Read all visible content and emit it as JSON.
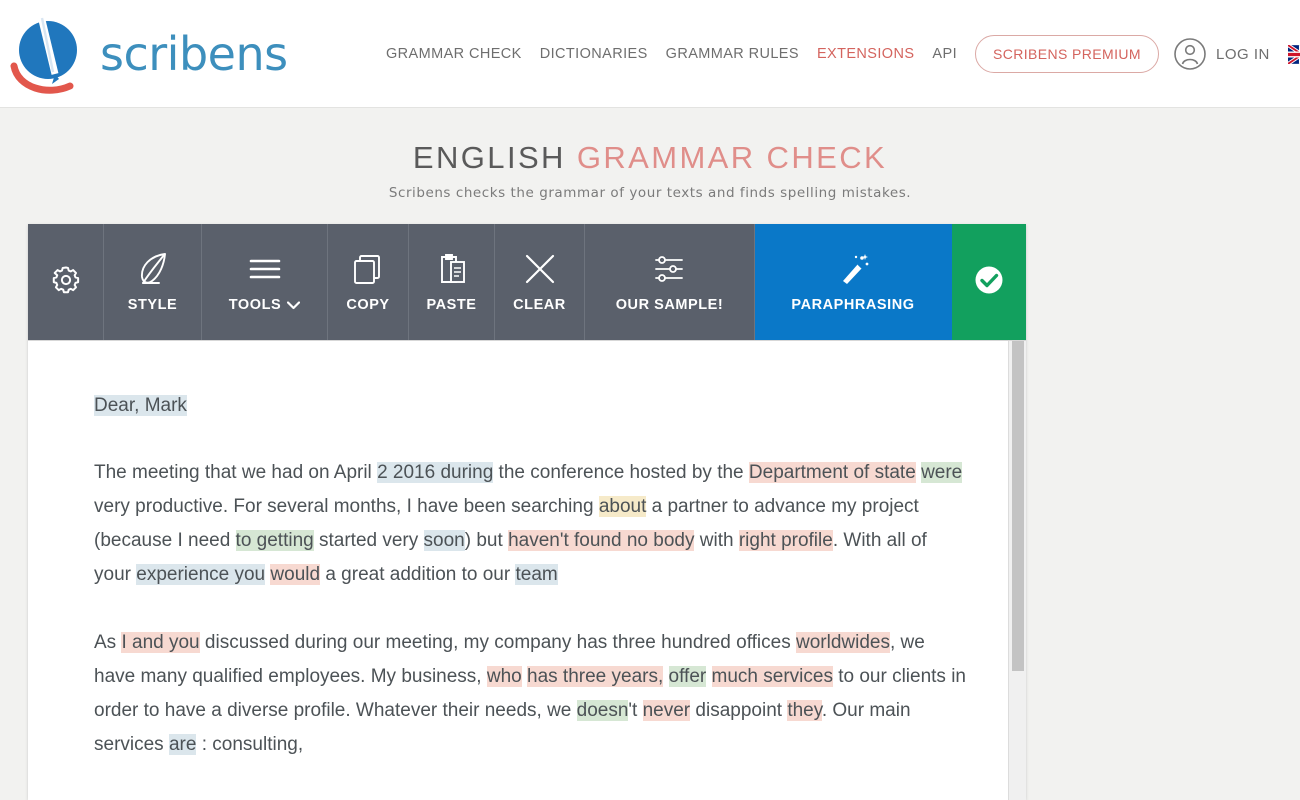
{
  "header": {
    "brand": "scribens",
    "logo_icon": "scribens-circle-pen-logo",
    "nav": [
      {
        "label": "GRAMMAR CHECK",
        "accent": false,
        "name": "nav-grammar-check"
      },
      {
        "label": "DICTIONARIES",
        "accent": false,
        "name": "nav-dictionaries"
      },
      {
        "label": "GRAMMAR RULES",
        "accent": false,
        "name": "nav-grammar-rules"
      },
      {
        "label": "EXTENSIONS",
        "accent": true,
        "name": "nav-extensions"
      },
      {
        "label": "API",
        "accent": false,
        "name": "nav-api"
      }
    ],
    "premium_label": "SCRIBENS PREMIUM",
    "login_label": "LOG IN",
    "account_icon": "user-circle-icon",
    "language_flag": "uk-flag-icon"
  },
  "title": {
    "part1": "ENGLISH",
    "part2": "GRAMMAR CHECK",
    "subtitle": "Scribens checks the grammar of your texts and finds spelling mistakes."
  },
  "toolbar": {
    "buttons": [
      {
        "label": "",
        "icon": "gear-icon",
        "name": "toolbar-settings"
      },
      {
        "label": "STYLE",
        "icon": "feather-quill-icon",
        "name": "toolbar-style"
      },
      {
        "label": "TOOLS",
        "icon": "hamburger-menu-icon",
        "caret": "chevron-down-icon",
        "name": "toolbar-tools"
      },
      {
        "label": "COPY",
        "icon": "copy-icon",
        "name": "toolbar-copy"
      },
      {
        "label": "PASTE",
        "icon": "paste-clipboard-icon",
        "name": "toolbar-paste"
      },
      {
        "label": "CLEAR",
        "icon": "close-x-icon",
        "name": "toolbar-clear"
      },
      {
        "label": "OUR SAMPLE!",
        "icon": "sliders-icon",
        "name": "toolbar-our-sample"
      },
      {
        "label": "PARAPHRASING",
        "icon": "magic-wand-icon",
        "name": "toolbar-paraphrasing"
      },
      {
        "label": "",
        "icon": "check-circle-icon",
        "name": "toolbar-check"
      }
    ],
    "colors": {
      "toolbar_bg": "#5a606b",
      "paraphrasing_bg": "#0a78c8",
      "check_bg": "#12a05e"
    }
  },
  "editor": {
    "greeting": {
      "text": "Dear, Mark",
      "highlight": "blue"
    },
    "paragraphs": [
      {
        "name": "paragraph-1",
        "runs": [
          {
            "t": "The meeting that we had on April ",
            "h": ""
          },
          {
            "t": "2 2016 during",
            "h": "blue"
          },
          {
            "t": " the conference hosted by the ",
            "h": ""
          },
          {
            "t": "Department of state",
            "h": "red"
          },
          {
            "t": " ",
            "h": ""
          },
          {
            "t": "were",
            "h": "green"
          },
          {
            "t": " very productive. For several months, I have been searching ",
            "h": ""
          },
          {
            "t": "about",
            "h": "yellow"
          },
          {
            "t": " a partner to advance my project (because I need ",
            "h": ""
          },
          {
            "t": "to getting",
            "h": "green"
          },
          {
            "t": " started very ",
            "h": ""
          },
          {
            "t": "soon",
            "h": "blue"
          },
          {
            "t": ") but ",
            "h": ""
          },
          {
            "t": "haven't found no body",
            "h": "red"
          },
          {
            "t": " with ",
            "h": ""
          },
          {
            "t": "right profile",
            "h": "red"
          },
          {
            "t": ". With all of your ",
            "h": ""
          },
          {
            "t": "experience you",
            "h": "blue"
          },
          {
            "t": " ",
            "h": ""
          },
          {
            "t": "would",
            "h": "red"
          },
          {
            "t": " a great addition to our ",
            "h": ""
          },
          {
            "t": "team",
            "h": "blue"
          }
        ]
      },
      {
        "name": "paragraph-2",
        "runs": [
          {
            "t": "As ",
            "h": ""
          },
          {
            "t": "I and you",
            "h": "red"
          },
          {
            "t": " discussed during our meeting, my company has three hundred offices ",
            "h": ""
          },
          {
            "t": "worldwides",
            "h": "red"
          },
          {
            "t": ", we have many qualified employees. My business, ",
            "h": ""
          },
          {
            "t": "who",
            "h": "red"
          },
          {
            "t": " ",
            "h": ""
          },
          {
            "t": "has three years,",
            "h": "red"
          },
          {
            "t": " ",
            "h": ""
          },
          {
            "t": "offer",
            "h": "green"
          },
          {
            "t": " ",
            "h": ""
          },
          {
            "t": "much services",
            "h": "red"
          },
          {
            "t": " to our clients in order to have a diverse profile. Whatever their needs, we ",
            "h": ""
          },
          {
            "t": "doesn",
            "h": "green"
          },
          {
            "t": "'t ",
            "h": ""
          },
          {
            "t": "never",
            "h": "red"
          },
          {
            "t": " disappoint ",
            "h": ""
          },
          {
            "t": "they",
            "h": "red"
          },
          {
            "t": ". Our main services ",
            "h": ""
          },
          {
            "t": "are",
            "h": "blue"
          },
          {
            "t": " : consulting,",
            "h": ""
          }
        ]
      }
    ],
    "highlight_colors": {
      "blue": "#dbe6ec",
      "red": "#f7d9d1",
      "green": "#d6e7d4",
      "yellow": "#f6eac9"
    }
  }
}
